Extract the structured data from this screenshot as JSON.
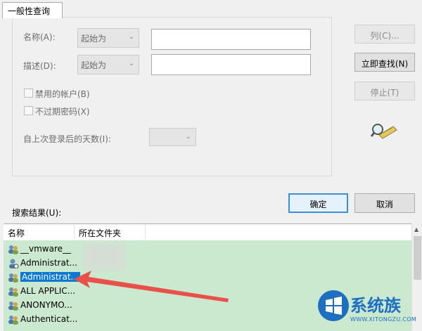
{
  "tab": {
    "label": "一般性查询"
  },
  "form": {
    "name_label": "名称(A):",
    "name_combo": "起始为",
    "desc_label": "描述(D):",
    "desc_combo": "起始为",
    "disabled_accounts": "禁用的帐户(B)",
    "no_expire_pwd": "不过期密码(X)",
    "days_label": "自上次登录后的天数(I):"
  },
  "buttons": {
    "columns": "列(C)...",
    "find_now": "立即查找(N)",
    "stop": "停止(T)",
    "ok": "确定",
    "cancel": "取消"
  },
  "results": {
    "label": "搜索结果(U):",
    "columns": [
      "名称",
      "所在文件夹"
    ],
    "rows": [
      {
        "name": "__vmware__"
      },
      {
        "name": "Administrat..."
      },
      {
        "name": "Administrat...",
        "selected": true
      },
      {
        "name": "ALL APPLIC..."
      },
      {
        "name": "ANONYMO..."
      },
      {
        "name": "Authenticat..."
      }
    ]
  },
  "watermark": {
    "brand": "系统族",
    "url": "WWW.XITONGZU.COM"
  },
  "colors": {
    "selection": "#0a78d7",
    "results_bg": "#cae9cf",
    "arrow": "#e8504a",
    "default_button_border": "#3b8fd6"
  }
}
